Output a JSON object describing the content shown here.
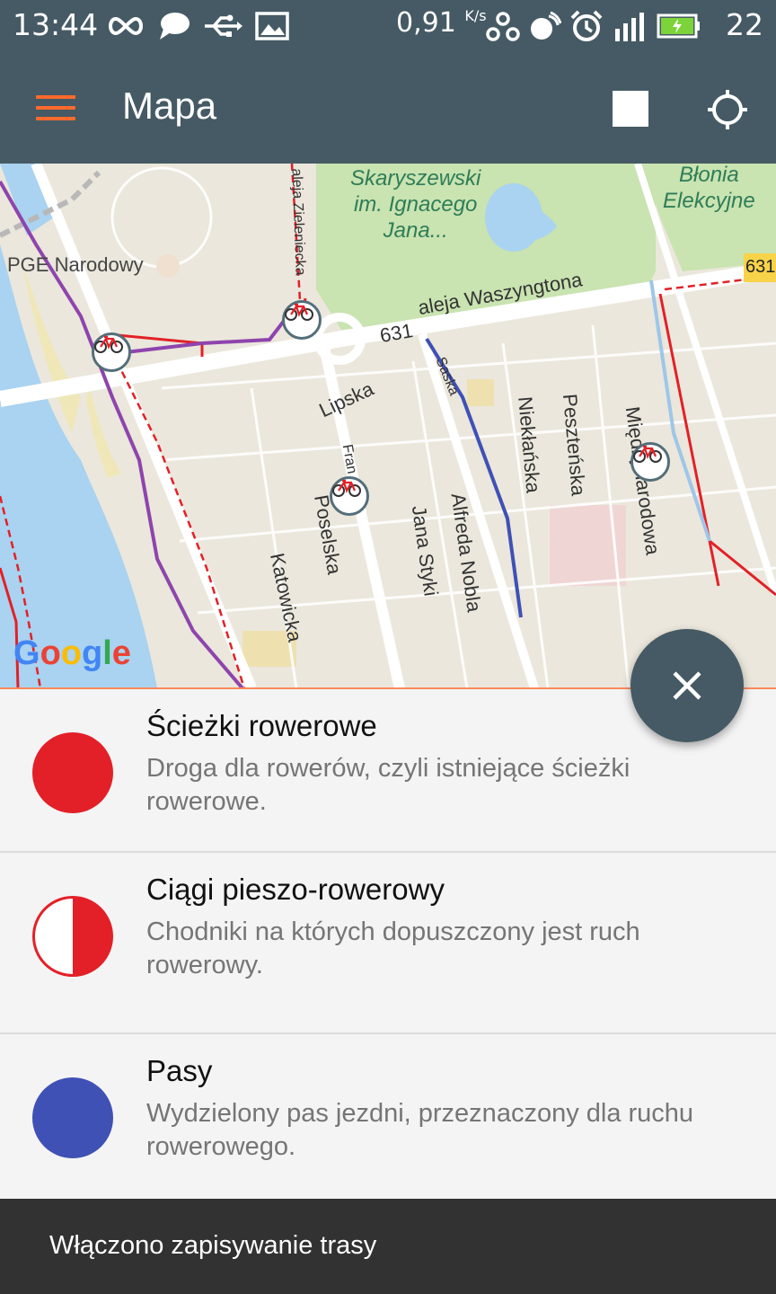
{
  "status_bar": {
    "time": "13:44",
    "speed_value": "0,91",
    "speed_unit": "K/s",
    "battery_percent": "22",
    "icons": [
      "infinity-icon",
      "chat-icon",
      "usb-icon",
      "image-icon",
      "vpn-icon",
      "hotspot-icon",
      "alarm-icon",
      "signal-icon",
      "battery-icon"
    ]
  },
  "app_bar": {
    "title": "Mapa",
    "menu_icon": "hamburger-menu-icon",
    "stop_icon": "stop-square-icon",
    "locate_icon": "gps-locate-icon",
    "menu_color": "#ff6a2c",
    "background": "#455a64"
  },
  "map": {
    "labels": {
      "stadium": "PGE Narodowy",
      "park1": "Skaryszewski im. Ignacego Jana...",
      "park1_line1": "Skaryszewski",
      "park1_line2": "im. Ignacego",
      "park1_line3": "Jana...",
      "park2_line1": "Błonia",
      "park2_line2": "Elekcyjne",
      "road_631": "631",
      "waszyngtona": "aleja Waszyngtona",
      "zieleniecka": "aleja Zieleniecka",
      "lipska": "Lipska",
      "saska": "Saska",
      "niektanska": "Niekłańska",
      "pestenska": "Peszteńska",
      "miedzynarodowa": "Międzynarodowa",
      "fran": "Fran",
      "poselska": "Poselska",
      "katowicka": "Katowicka",
      "jana_styki": "Jana Styki",
      "alfreda_nobla": "Alfreda Nobla",
      "shield_631": "631"
    },
    "google_logo": "Google",
    "marker_icon": "bicycle-icon"
  },
  "fab": {
    "icon": "close-icon"
  },
  "legend": [
    {
      "title": "Ścieżki rowerowe",
      "description": "Droga dla rowerów, czyli istniejące ścieżki rowerowe.",
      "color": "#e32027",
      "style": "solid"
    },
    {
      "title": "Ciągi pieszo-rowerowy",
      "description": "Chodniki na których dopuszczony jest ruch rowerowy.",
      "color": "#e32027",
      "style": "half"
    },
    {
      "title": "Pasy",
      "description": "Wydzielony pas jezdni, przeznaczony dla ruchu rowerowego.",
      "color": "#3f51b5",
      "style": "solid"
    }
  ],
  "snackbar": {
    "text": "Włączono zapisywanie trasy"
  }
}
